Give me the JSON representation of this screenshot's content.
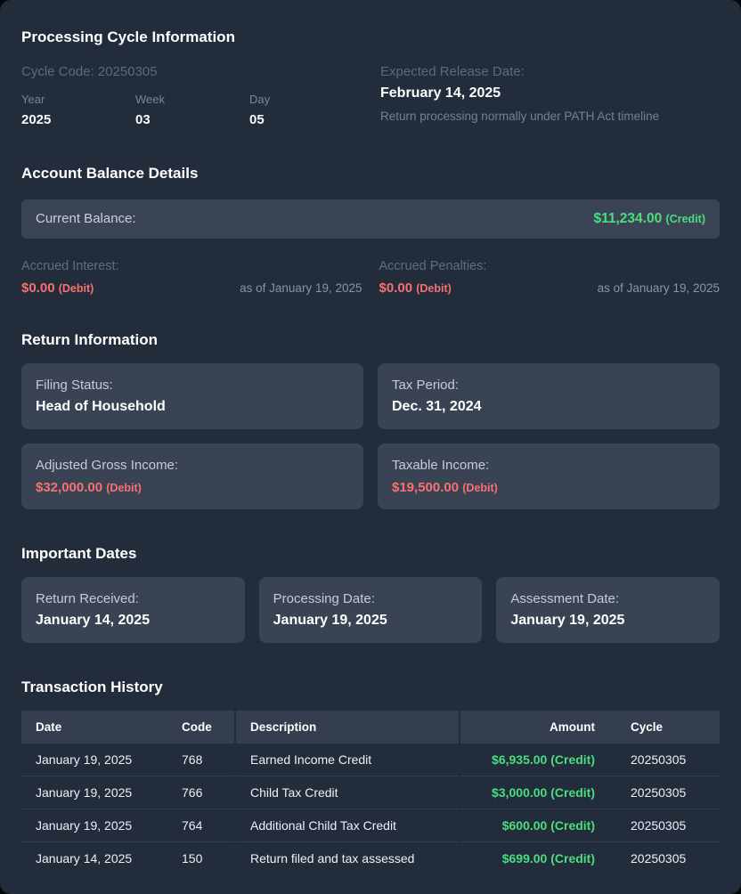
{
  "colors": {
    "page_bg": "#222c3b",
    "card_bg": "#3a4353",
    "credit_green": "#4ade80",
    "debit_red": "#f87171"
  },
  "processing_cycle": {
    "title": "Processing Cycle Information",
    "cycle_code": "Cycle Code: 20250305",
    "fields": [
      {
        "label": "Year",
        "value": "2025"
      },
      {
        "label": "Week",
        "value": "03"
      },
      {
        "label": "Day",
        "value": "05"
      }
    ],
    "release": {
      "label": "Expected Release Date:",
      "value": "February 14, 2025",
      "note": "Return processing normally under PATH Act timeline"
    }
  },
  "account_balance": {
    "title": "Account Balance Details",
    "current": {
      "label": "Current Balance:",
      "amount": "$11,234.00",
      "type": "(Credit)"
    },
    "interest": {
      "label": "Accrued Interest:",
      "amount": "$0.00",
      "type": "(Debit)",
      "as_of": "as of January 19, 2025"
    },
    "penalties": {
      "label": "Accrued Penalties:",
      "amount": "$0.00",
      "type": "(Debit)",
      "as_of": "as of January 19, 2025"
    }
  },
  "return_information": {
    "title": "Return Information",
    "filing_status": {
      "label": "Filing Status:",
      "value": "Head of Household"
    },
    "tax_period": {
      "label": "Tax Period:",
      "value": "Dec. 31, 2024"
    },
    "agi": {
      "label": "Adjusted Gross Income:",
      "amount": "$32,000.00",
      "type": "(Debit)"
    },
    "taxable": {
      "label": "Taxable Income:",
      "amount": "$19,500.00",
      "type": "(Debit)"
    }
  },
  "important_dates": {
    "title": "Important Dates",
    "cards": [
      {
        "label": "Return Received:",
        "value": "January 14, 2025"
      },
      {
        "label": "Processing Date:",
        "value": "January 19, 2025"
      },
      {
        "label": "Assessment Date:",
        "value": "January 19, 2025"
      }
    ]
  },
  "transactions": {
    "title": "Transaction History",
    "columns": {
      "date": "Date",
      "code": "Code",
      "description": "Description",
      "amount": "Amount",
      "cycle": "Cycle"
    },
    "rows": [
      {
        "date": "January 19, 2025",
        "code": "768",
        "description": "Earned Income Credit",
        "amount": "$6,935.00",
        "type": "(Credit)",
        "cycle": "20250305"
      },
      {
        "date": "January 19, 2025",
        "code": "766",
        "description": "Child Tax Credit",
        "amount": "$3,000.00",
        "type": "(Credit)",
        "cycle": "20250305"
      },
      {
        "date": "January 19, 2025",
        "code": "764",
        "description": "Additional Child Tax Credit",
        "amount": "$600.00",
        "type": "(Credit)",
        "cycle": "20250305"
      },
      {
        "date": "January 14, 2025",
        "code": "150",
        "description": "Return filed and tax assessed",
        "amount": "$699.00",
        "type": "(Credit)",
        "cycle": "20250305"
      }
    ]
  }
}
